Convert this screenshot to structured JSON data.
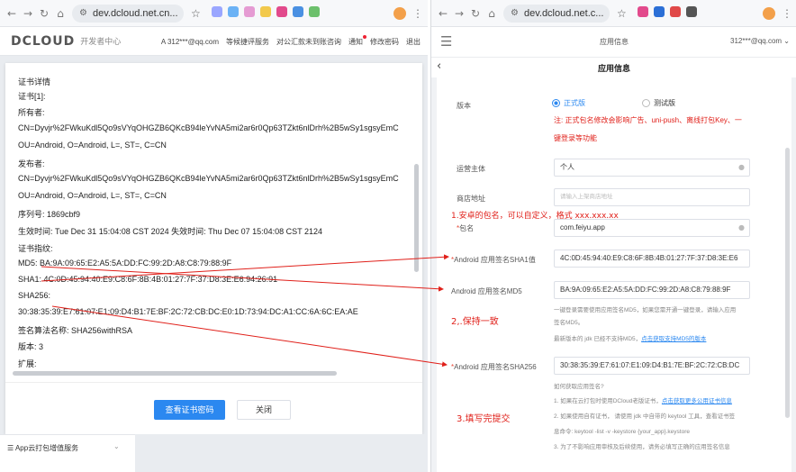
{
  "left_browser": {
    "url": "dev.dcloud.net.cn...",
    "ext_colors": [
      "#9aa6ff",
      "#6bb2f5",
      "#e59bd3",
      "#f2c94c",
      "#e24a8c",
      "#4a90e2",
      "#6cc06c"
    ]
  },
  "right_browser": {
    "url": "dev.dcloud.net.c...",
    "ext_colors": [
      "#e24a8c",
      "#2b6fd6",
      "#e04848",
      "#555555"
    ]
  },
  "dc_header": {
    "logo": "DCLOUD",
    "logo_sub": "开发者中心",
    "user_email": "A 312***@qq.com",
    "nav": [
      "等候捷评服务",
      "对公汇款未到账咨询",
      "通知",
      "修改密码",
      "退出"
    ]
  },
  "cert_modal": {
    "title": "证书详情",
    "lines": [
      "证书[1]:",
      "所有者:",
      "CN=Dyvjr%2FWkuKdl5Qo9sVYqOHGZB6QKcB94leYvNA5mi2ar6r0Qp63TZkt6nlDrh%2B5wSy1sgsyEmC",
      "OU=Android, O=Android, L=, ST=, C=CN",
      "发布者:",
      "CN=Dyvjr%2FWkuKdl5Qo9sVYqOHGZB6QKcB94leYvNA5mi2ar6r0Qp63TZkt6nlDrh%2B5wSy1sgsyEmC",
      "OU=Android, O=Android, L=, ST=, C=CN",
      "序列号:  1869cbf9",
      "生效时间:  Tue Dec 31 15:04:08 CST 2024  失效时间:   Thu Dec 07 15:04:08 CST 2124",
      "证书指纹:",
      "MD5: BA:9A:09:65:E2:A5:5A:DD:FC:99:2D:A8:C8:79:88:9F",
      "SHA1: 4C:0D:45:94:40:E9:C8:6F:8B:4B:01:27:7F:37:D8:3E:E6:94:26:91",
      "SHA256:",
      "30:38:35:39:E7:61:07:E1:09:D4:B1:7E:BF:2C:72:CB:DC:E0:1D:73:94:DC:A1:CC:6A:6C:EA:AE",
      "签名算法名称:  SHA256withRSA",
      "版本:  3",
      "扩展:"
    ],
    "view_button": "查看证书密码",
    "close_button": "关闭"
  },
  "bottom_nav": {
    "label": "☰ App云打包增值服务",
    "chevron": "⌄"
  },
  "mobile": {
    "header_title": "应用信息",
    "user": "312***@qq.com ⌄",
    "subheader_title": "应用信息",
    "form": {
      "version_label": "版本",
      "version_options": [
        "正式版",
        "测试版"
      ],
      "version_note_1": "注: 正式包名修改会影响广告、uni-push、离线打包Key、一",
      "version_note_2": "键登录等功能",
      "operator_label": "运营主体",
      "operator_value": "个人",
      "store_label": "商店地址",
      "store_placeholder": "请输入上架商店地址",
      "package_label": "包名",
      "package_value": "com.feiyu.app",
      "sha1_label": "Android 应用签名SHA1值",
      "sha1_value": "4C:0D:45:94:40:E9:C8:6F:8B:4B:01:27:7F:37:D8:3E:E6",
      "md5_label": "Android 应用签名MD5",
      "md5_value": "BA:9A:09:65:E2:A5:5A:DD:FC:99:2D:A8:C8:79:88:9F",
      "md5_hint_1": "一键登录需要使用应用签名MD5，如果您需开通一键登录，请输入应用",
      "md5_hint_2": "签名MD5。",
      "md5_hint_3": "最新版本的 jdk 已经不支持MD5，",
      "md5_hint_link": "点击获取支持MD5的版本",
      "sha256_label": "Android 应用签名SHA256",
      "sha256_value": "30:38:35:39:E7:61:07:E1:09:D4:B1:7E:BF:2C:72:CB:DC",
      "how_title": "如何获取应用签名?",
      "how_1": "1. 如果在云打包时使用DCloud老版证书，",
      "how_1_link": "点击获取更多公用证书信息",
      "how_2": "2. 如果使用自有证书，  请使用 jdk 中自带的 keytool 工具，查看证书签",
      "how_2b": "息命令: keytool -list -v -keystore {your_app}.keystore",
      "how_3": "3. 为了不影响应用审核及后续使用，请务必填写正确的应用签名信息"
    },
    "annotations": {
      "note_1": "1.安卓的包名，可以自定义，格式 xxx.xxx.xx",
      "note_2": "2,.保持一致",
      "note_3": "3.填写完提交"
    }
  },
  "colors": {
    "accent": "#2b88f0",
    "annotation_red": "#e0201a"
  }
}
